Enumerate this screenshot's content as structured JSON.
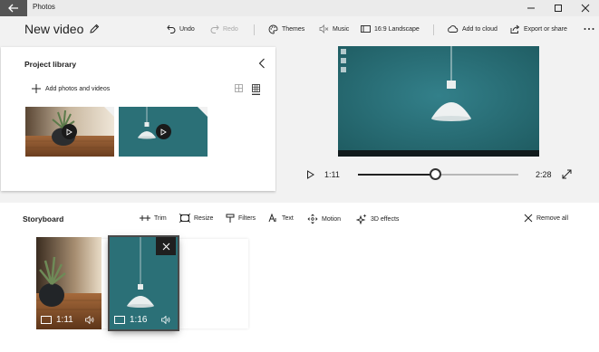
{
  "window": {
    "app_title": "Photos"
  },
  "toolbar": {
    "project_title": "New video",
    "undo_label": "Undo",
    "redo_label": "Redo",
    "themes_label": "Themes",
    "music_label": "Music",
    "aspect_label": "16:9 Landscape",
    "cloud_label": "Add to cloud",
    "export_label": "Export or share"
  },
  "library": {
    "title": "Project library",
    "add_label": "Add photos and videos",
    "items": [
      {
        "icon": "play-icon"
      },
      {
        "icon": "play-icon"
      }
    ]
  },
  "preview": {
    "current_time": "1:11",
    "total_time": "2:28",
    "progress": 0.48
  },
  "storyboard": {
    "title": "Storyboard",
    "tools": {
      "trim": "Trim",
      "resize": "Resize",
      "filters": "Filters",
      "text": "Text",
      "motion": "Motion",
      "effects": "3D effects"
    },
    "remove_all": "Remove all",
    "clips": [
      {
        "duration": "1:11"
      },
      {
        "duration": "1:16",
        "selected": true
      }
    ]
  },
  "colors": {
    "accent_teal": "#2b7077",
    "chrome": "#f2f2f2"
  }
}
